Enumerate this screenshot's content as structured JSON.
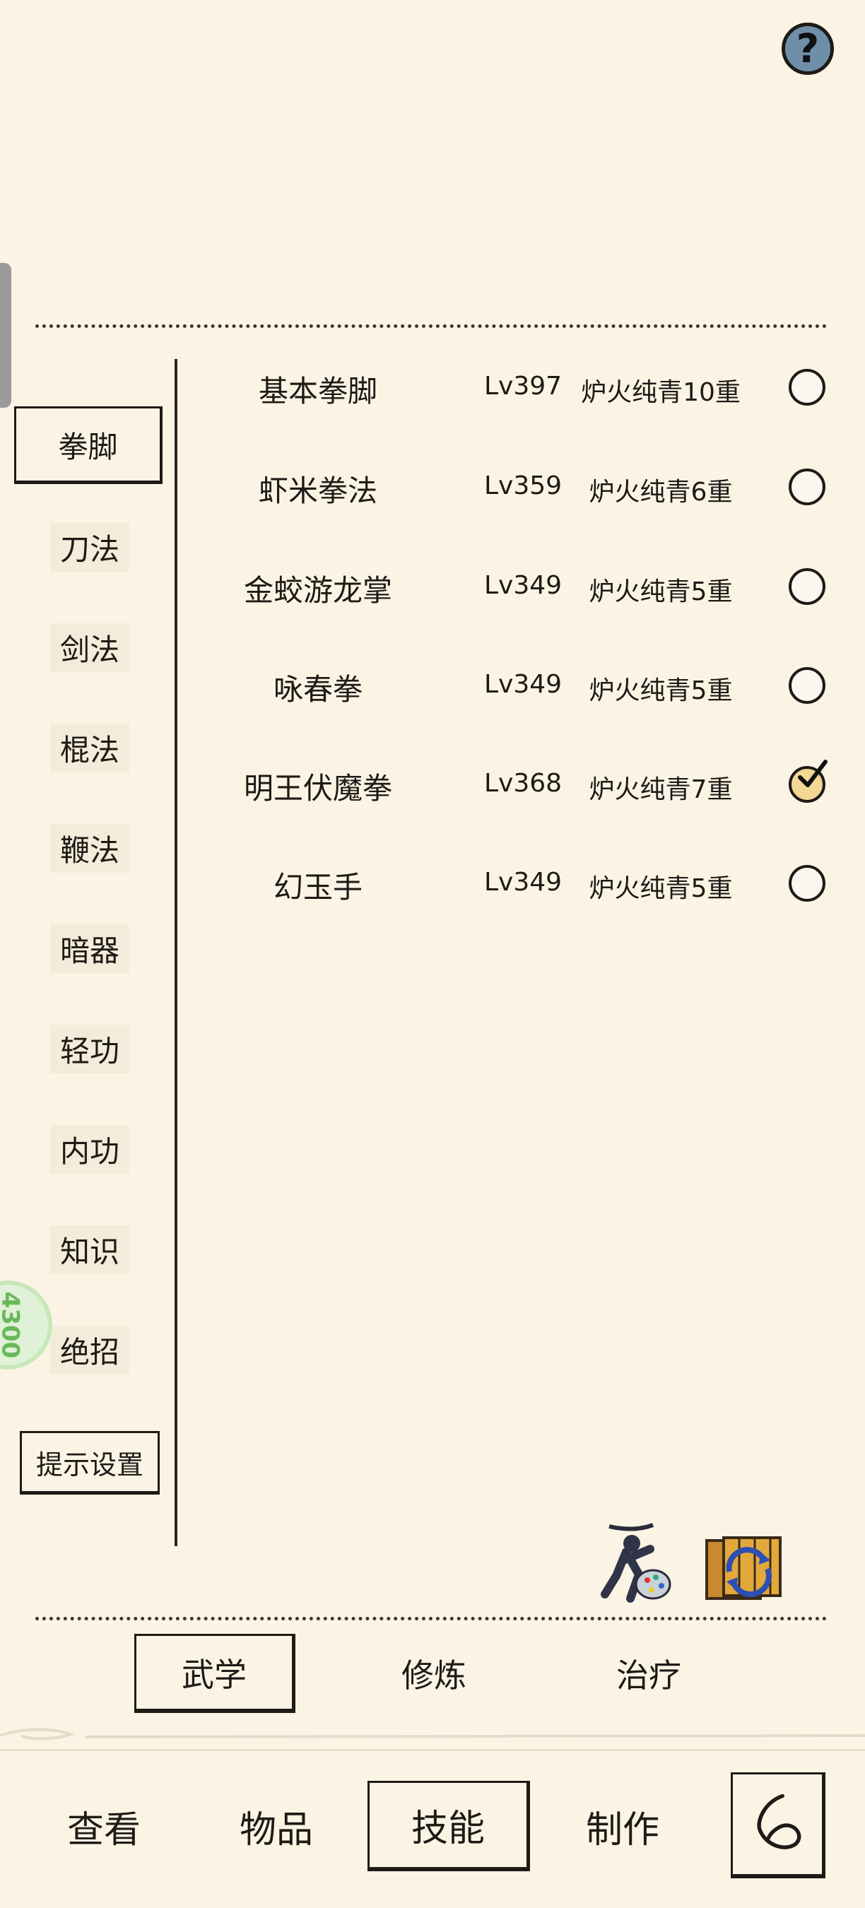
{
  "header": {
    "help_label": "?"
  },
  "categories": [
    {
      "label": "拳脚",
      "selected": true
    },
    {
      "label": "刀法"
    },
    {
      "label": "剑法"
    },
    {
      "label": "棍法"
    },
    {
      "label": "鞭法"
    },
    {
      "label": "暗器"
    },
    {
      "label": "轻功"
    },
    {
      "label": "内功"
    },
    {
      "label": "知识"
    },
    {
      "label": "绝招"
    }
  ],
  "hint_settings_label": "提示设置",
  "side_badge_text": "4300",
  "skills": [
    {
      "name": "基本拳脚",
      "level": "Lv397",
      "rank": "炉火纯青10重",
      "checked": false
    },
    {
      "name": "虾米拳法",
      "level": "Lv359",
      "rank": "炉火纯青6重",
      "checked": false
    },
    {
      "name": "金蛟游龙掌",
      "level": "Lv349",
      "rank": "炉火纯青5重",
      "checked": false
    },
    {
      "name": "咏春拳",
      "level": "Lv349",
      "rank": "炉火纯青5重",
      "checked": false
    },
    {
      "name": "明王伏魔拳",
      "level": "Lv368",
      "rank": "炉火纯青7重",
      "checked": true
    },
    {
      "name": "幻玉手",
      "level": "Lv349",
      "rank": "炉火纯青5重",
      "checked": false
    }
  ],
  "subtabs": [
    {
      "label": "武学",
      "selected": true
    },
    {
      "label": "修炼"
    },
    {
      "label": "治疗"
    }
  ],
  "nav": [
    {
      "label": "查看"
    },
    {
      "label": "物品"
    },
    {
      "label": "技能",
      "selected": true
    },
    {
      "label": "制作"
    }
  ],
  "icons": {
    "help": "question-icon",
    "fighter_palette": "fighter-palette-icon",
    "book_swap": "book-swap-icon",
    "back": "back-swirl-icon",
    "check": "check-icon"
  }
}
